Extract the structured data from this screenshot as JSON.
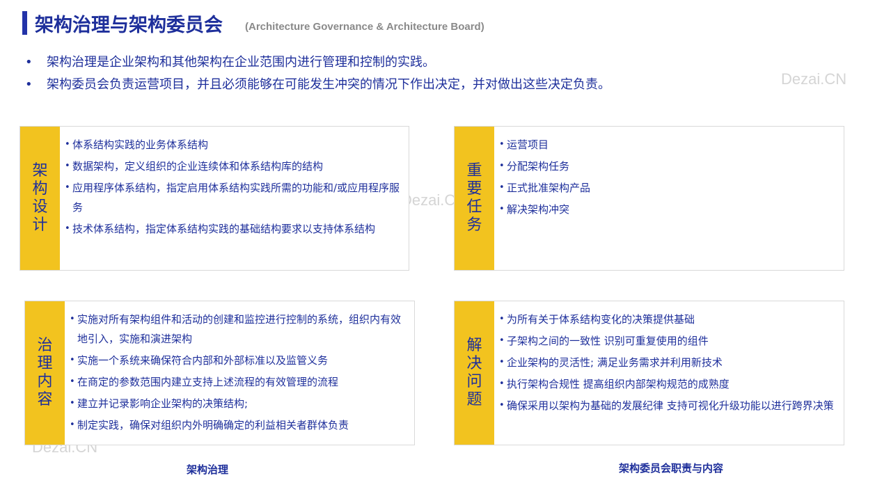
{
  "header": {
    "title": "架构治理与架构委员会",
    "subtitle": "(Architecture Governance  & Architecture Board)"
  },
  "intro": [
    "架构治理是企业架构和其他架构在企业范围内进行管理和控制的实践。",
    "架构委员会负责运营项目，并且必须能够在可能发生冲突的情况下作出决定，并对做出这些决定负责。"
  ],
  "watermark": "Dezai.CN",
  "boxes": [
    {
      "label": "架构设计",
      "items": [
        "体系结构实践的业务体系结构",
        "数据架构，定义组织的企业连续体和体系结构库的结构",
        "应用程序体系结构，指定启用体系结构实践所需的功能和/或应用程序服务",
        "技术体系结构，指定体系结构实践的基础结构要求以支持体系结构"
      ]
    },
    {
      "label": "重要任务",
      "items": [
        "运营项目",
        "分配架构任务",
        "正式批准架构产品",
        "解决架构冲突"
      ]
    },
    {
      "label": "治理内容",
      "items": [
        "实施对所有架构组件和活动的创建和监控进行控制的系统，组织内有效地引入，实施和演进架构",
        "实施一个系统来确保符合内部和外部标准以及监管义务",
        "在商定的参数范围内建立支持上述流程的有效管理的流程",
        "建立并记录影响企业架构的决策结构;",
        "制定实践，确保对组织内外明确确定的利益相关者群体负责"
      ]
    },
    {
      "label": "解决问题",
      "items": [
        "为所有关于体系结构变化的决策提供基础",
        "子架构之间的一致性 识别可重复使用的组件",
        "企业架构的灵活性; 满足业务需求并利用新技术",
        "执行架构合规性 提高组织内部架构规范的成熟度",
        "确保采用以架构为基础的发展纪律 支持可视化升级功能以进行跨界决策"
      ]
    }
  ],
  "captions": {
    "left": "架构治理",
    "right": "架构委员会职责与内容"
  },
  "colors": {
    "accent_yellow": "#f2c31f",
    "title_blue": "#1e2f9b",
    "border": "#d9d9d9"
  }
}
